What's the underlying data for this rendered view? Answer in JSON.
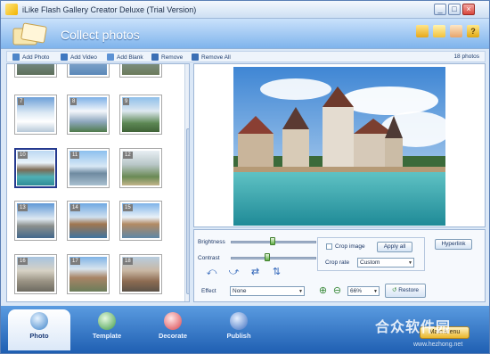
{
  "window": {
    "title": "iLike Flash Gallery Creator Deluxe (Trial Version)"
  },
  "header": {
    "title": "Collect photos"
  },
  "toolbar": {
    "add_photo": "Add Photo",
    "add_video": "Add Video",
    "add_blank": "Add Blank",
    "remove": "Remove",
    "remove_all": "Remove All",
    "photo_count": "18 photos"
  },
  "gallery": {
    "thumbs": [
      {
        "num": "7"
      },
      {
        "num": "8"
      },
      {
        "num": "9"
      },
      {
        "num": "10"
      },
      {
        "num": "11"
      },
      {
        "num": "12"
      },
      {
        "num": "13"
      },
      {
        "num": "14"
      },
      {
        "num": "15"
      },
      {
        "num": "16"
      },
      {
        "num": "17"
      },
      {
        "num": "18"
      }
    ],
    "selected_num": "10"
  },
  "controls": {
    "brightness_label": "Brightness",
    "contrast_label": "Contrast",
    "brightness_value": 0.5,
    "contrast_value": 0.5,
    "effect_label": "Effect",
    "effect_value": "None",
    "crop_image_label": "Crop image",
    "apply_all_label": "Apply all",
    "crop_rate_label": "Crop rate",
    "crop_rate_value": "Custom",
    "hyperlink_label": "Hyperlink",
    "zoom_value": "66%",
    "restore_label": "Restore"
  },
  "nav": {
    "photo": "Photo",
    "template": "Template",
    "decorate": "Decorate",
    "publish": "Publish",
    "main_menu": "Main Menu"
  },
  "watermark": {
    "text": "合众软件园",
    "sub": "www.hezhong.net"
  }
}
